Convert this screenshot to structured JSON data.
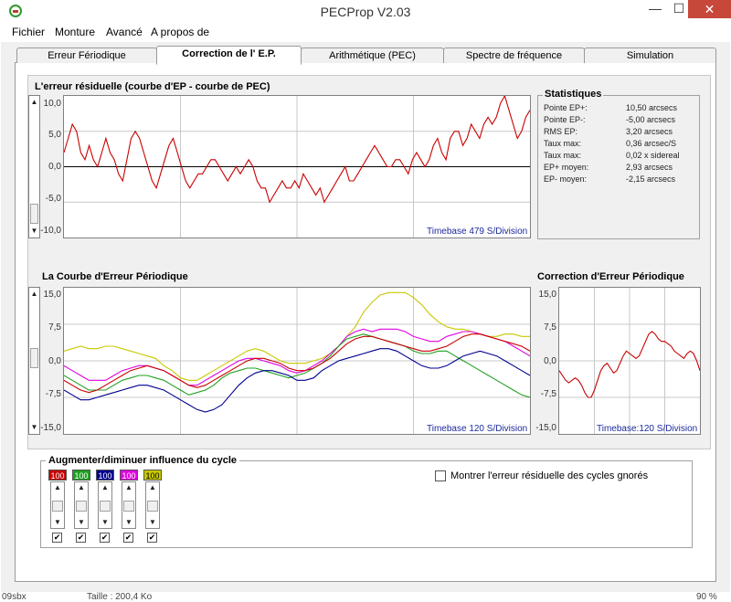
{
  "window": {
    "title": "PECProp V2.03",
    "minimize": "—",
    "maximize": "☐",
    "close": "✕"
  },
  "menu": [
    "Fichier",
    "Monture",
    "Avancé",
    "A propos de"
  ],
  "tabs": [
    {
      "label": "Erreur Fériodique",
      "active": false
    },
    {
      "label": "Correction de l' E.P.",
      "active": true
    },
    {
      "label": "Arithmétique (PEC)",
      "active": false
    },
    {
      "label": "Spectre de fréquence",
      "active": false
    },
    {
      "label": "Simulation",
      "active": false
    }
  ],
  "residual": {
    "title": "L'erreur résiduelle (courbe d'EP - courbe de PEC)",
    "timebase": "Timebase 479 S/Division",
    "yticks": [
      "10,0",
      "5,0",
      "0,0",
      "-5,0",
      "-10,0"
    ],
    "ylim": [
      -10,
      10
    ],
    "color": "#c80000",
    "points": [
      2,
      4,
      6,
      5,
      2,
      1,
      3,
      1,
      0,
      2,
      4,
      2,
      1,
      -1,
      -2,
      1,
      4,
      5,
      4,
      2,
      0,
      -2,
      -3,
      -1,
      1,
      3,
      4,
      2,
      0,
      -2,
      -3,
      -2,
      -1,
      -1,
      0,
      1,
      1,
      0,
      -1,
      -2,
      -1,
      0,
      -1,
      0,
      1,
      0,
      -2,
      -3,
      -3,
      -5,
      -4,
      -3,
      -2,
      -3,
      -3,
      -2,
      -3,
      -1,
      -2,
      -3,
      -4,
      -3,
      -5,
      -4,
      -3,
      -2,
      -1,
      0,
      -2,
      -2,
      -1,
      0,
      1,
      2,
      3,
      2,
      1,
      0,
      0,
      1,
      1,
      0,
      -1,
      1,
      2,
      1,
      0,
      1,
      3,
      4,
      2,
      1,
      4,
      5,
      5,
      3,
      4,
      6,
      5,
      4,
      6,
      7,
      6,
      7,
      9,
      10,
      8,
      6,
      4,
      5,
      7,
      8
    ]
  },
  "stats": {
    "title": "Statistiques",
    "rows": [
      {
        "label": "Pointe EP+:",
        "value": "10,50 arcsecs"
      },
      {
        "label": "Pointe EP-:",
        "value": "-5,00 arcsecs"
      },
      {
        "label": "RMS EP:",
        "value": "3,20 arcsecs"
      },
      {
        "label": "Taux max:",
        "value": "0,36 arcsec/S"
      },
      {
        "label": "Taux max:",
        "value": "0,02 x sidereal"
      },
      {
        "label": "EP+ moyen:",
        "value": "2,93 arcsecs"
      },
      {
        "label": "EP- moyen:",
        "value": "-2,15 arcsecs"
      }
    ]
  },
  "periodic": {
    "title": "La Courbe d'Erreur Périodique",
    "timebase": "Timebase 120 S/Division",
    "yticks": [
      "15,0",
      "7,5",
      "0,0",
      "-7,5",
      "-15,0"
    ],
    "ylim": [
      -15,
      15
    ],
    "series": [
      {
        "color": "#c8c800",
        "values": [
          2,
          2.5,
          3,
          2.5,
          2.5,
          3,
          3,
          2.5,
          2,
          1.5,
          1,
          0.5,
          -1,
          -2,
          -3.5,
          -4,
          -4,
          -3,
          -2,
          -1,
          0,
          1,
          2,
          2.5,
          2,
          1,
          0,
          -0.5,
          -0.5,
          -0.5,
          0,
          0.5,
          1.5,
          3,
          5,
          7,
          10,
          12,
          13.5,
          14,
          14,
          14,
          13,
          11.5,
          9.5,
          8,
          7,
          6.5,
          6.5,
          6,
          5.5,
          5,
          5,
          5.5,
          5.5,
          5,
          5
        ]
      },
      {
        "color": "#e000e0",
        "values": [
          -1,
          -2,
          -3,
          -4,
          -4,
          -4,
          -3,
          -2,
          -1.5,
          -1,
          -1,
          -1.5,
          -2,
          -3,
          -4,
          -5,
          -5,
          -4,
          -3,
          -2,
          -1,
          0,
          0.5,
          0.5,
          0,
          -0.5,
          -1,
          -2,
          -2.5,
          -2,
          -1,
          0,
          1.5,
          3,
          5,
          6,
          6.5,
          6,
          6.5,
          6.5,
          6.5,
          6,
          5,
          4.5,
          4,
          4,
          5,
          5.5,
          6,
          6,
          5.5,
          5,
          4.5,
          4,
          3,
          2,
          1
        ]
      },
      {
        "color": "#20a020",
        "values": [
          -3,
          -4,
          -5,
          -6,
          -6,
          -6,
          -5,
          -4,
          -3.5,
          -3,
          -3,
          -3.5,
          -4,
          -5,
          -6,
          -7,
          -6.5,
          -6,
          -5,
          -3.5,
          -2.5,
          -2,
          -1.5,
          -1.5,
          -2,
          -2.5,
          -3,
          -3.5,
          -3,
          -2.5,
          -1.5,
          -0.5,
          1,
          3,
          4.5,
          5,
          5.5,
          5,
          4.5,
          4,
          3.5,
          3,
          2,
          1.5,
          1.5,
          2,
          2,
          1,
          0,
          -1,
          -2,
          -3,
          -4,
          -5,
          -6,
          -7,
          -7.5
        ]
      },
      {
        "color": "#000090",
        "values": [
          -6,
          -7,
          -8,
          -8,
          -7.5,
          -7,
          -6.5,
          -6,
          -5.5,
          -5,
          -5,
          -5.5,
          -6,
          -7,
          -8,
          -9,
          -10,
          -10.5,
          -10,
          -9,
          -7,
          -5,
          -3.5,
          -2.5,
          -2,
          -2,
          -2.5,
          -3,
          -4,
          -4,
          -3.5,
          -2,
          -1,
          0,
          0.5,
          1,
          1.5,
          2,
          2.5,
          2.5,
          2,
          1,
          0,
          -1,
          -1.5,
          -1.5,
          -1,
          0,
          1,
          1.5,
          2,
          1.5,
          1,
          0,
          -1,
          -2,
          -3
        ]
      },
      {
        "color": "#c80000",
        "values": [
          -4,
          -5,
          -6,
          -6.5,
          -6,
          -5,
          -4,
          -3,
          -2,
          -1.5,
          -1,
          -1.5,
          -2,
          -3,
          -4,
          -5,
          -5.5,
          -5,
          -4,
          -3,
          -2,
          -1,
          0,
          0.5,
          0.5,
          0,
          -0.5,
          -1.5,
          -2,
          -2,
          -1.5,
          -0.5,
          0.5,
          2,
          3.5,
          4.5,
          5,
          5,
          4.5,
          4,
          3.5,
          3,
          2.5,
          2,
          2,
          2.5,
          3,
          4,
          5,
          5.5,
          5.5,
          5,
          4.5,
          4,
          3.5,
          3,
          2
        ]
      }
    ]
  },
  "correction": {
    "title": "Correction d'Erreur Périodique",
    "timebase": "Timebase:120 S/Division",
    "yticks": [
      "15,0",
      "7,5",
      "0,0",
      "-7,5",
      "-15,0"
    ],
    "ylim": [
      -15,
      15
    ],
    "color": "#c80000",
    "values": [
      -2,
      -3,
      -4,
      -4.5,
      -4,
      -3.5,
      -4,
      -5,
      -6.5,
      -7.5,
      -7.5,
      -6,
      -4,
      -2,
      -1,
      -0.5,
      -1.5,
      -2.5,
      -2,
      -0.5,
      1,
      2,
      1.5,
      1,
      0.5,
      1,
      2.5,
      4,
      5.5,
      6,
      5.5,
      4.5,
      4,
      4,
      3.5,
      3,
      2,
      1.5,
      1,
      0.5,
      1.5,
      2,
      1.5,
      0,
      -2
    ]
  },
  "cycles": {
    "title": "Augmenter/diminuer influence du cycle",
    "items": [
      {
        "value": "100",
        "color": "#c80000",
        "text": "#ffffff"
      },
      {
        "value": "100",
        "color": "#20a020",
        "text": "#ffffff"
      },
      {
        "value": "100",
        "color": "#000090",
        "text": "#ffffff"
      },
      {
        "value": "100",
        "color": "#e000e0",
        "text": "#ffffff"
      },
      {
        "value": "100",
        "color": "#c8c800",
        "text": "#000000"
      }
    ],
    "check_mark": "✔",
    "show_ignored": {
      "label": "Montrer l'erreur résiduelle des cycles gnorés",
      "checked": false
    }
  },
  "statusbar": {
    "left": "09sbx",
    "middle": "Taille : 200,4 Ko",
    "right": "90 %"
  }
}
